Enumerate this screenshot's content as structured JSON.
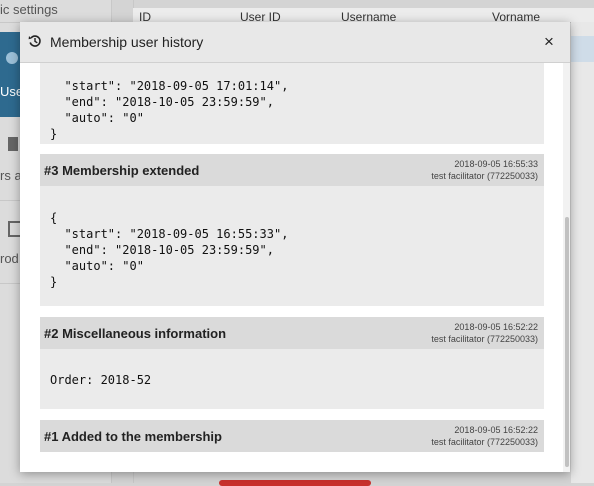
{
  "background": {
    "sidebar_top_text": "ic settings",
    "sidebar_item_users": "Use",
    "sidebar_item_2": "rs a",
    "sidebar_item_3": "rod",
    "table_headers": [
      "ID",
      "User ID",
      "Username",
      "Vorname"
    ]
  },
  "modal": {
    "title": "Membership user history",
    "close_label": "×",
    "history_icon": "history-icon",
    "entries": [
      {
        "title": "",
        "date": "",
        "user": "",
        "content": "  \"start\": \"2018-09-05 17:01:14\",\n  \"end\": \"2018-10-05 23:59:59\",\n  \"auto\": \"0\"\n}"
      },
      {
        "title": "#3 Membership extended",
        "date": "2018-09-05 16:55:33",
        "user": "test facilitator (772250033)",
        "content": "{\n  \"start\": \"2018-09-05 16:55:33\",\n  \"end\": \"2018-10-05 23:59:59\",\n  \"auto\": \"0\"\n}"
      },
      {
        "title": "#2 Miscellaneous information",
        "date": "2018-09-05 16:52:22",
        "user": "test facilitator (772250033)",
        "content": "Order: 2018-52"
      },
      {
        "title": "#1 Added to the membership",
        "date": "2018-09-05 16:52:22",
        "user": "test facilitator (772250033)",
        "content": ""
      }
    ]
  },
  "colors": {
    "sidebar_active": "#2e6a8f",
    "danger_button": "#c9302c"
  }
}
